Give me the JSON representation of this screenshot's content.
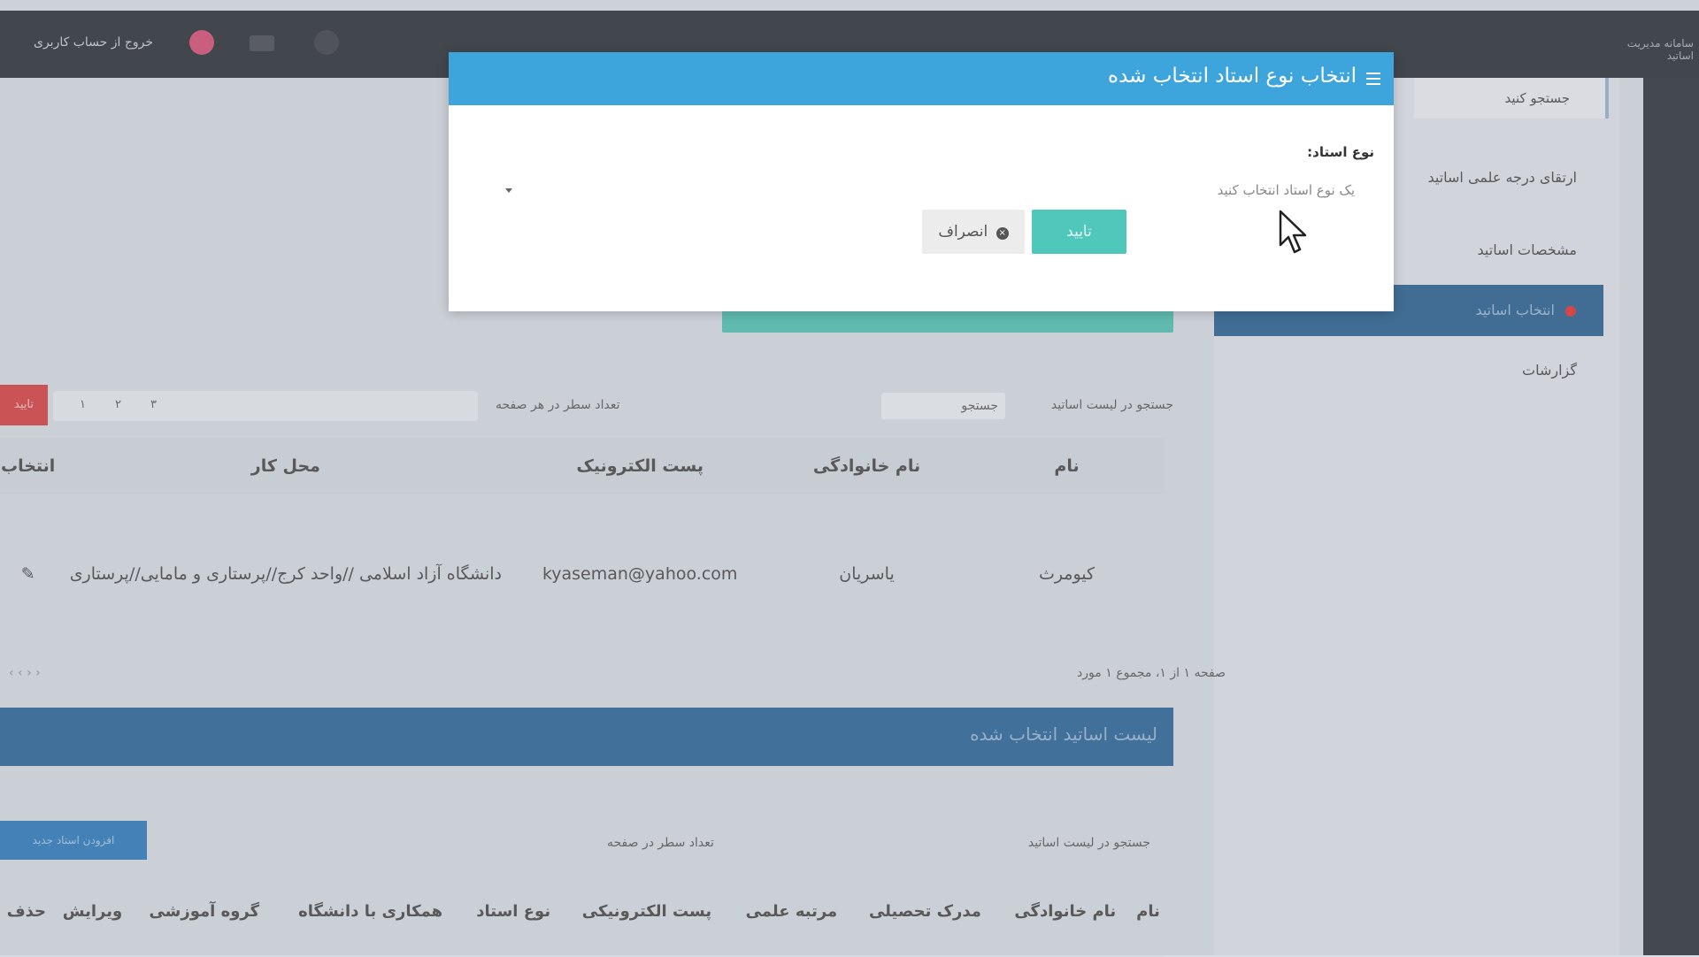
{
  "topbar": {
    "user_label": "خروج از حساب کاربری",
    "app_title": "سامانه مدیریت اساتید"
  },
  "sidebar": {
    "search_label": "جستجو کنید",
    "items": [
      {
        "label": "ارتقای درجه علمی اساتید"
      },
      {
        "label": "مشخصات اساتید"
      },
      {
        "label": "انتخاب اساتید",
        "active": true
      },
      {
        "label": "گزارشات"
      }
    ]
  },
  "grid1": {
    "search_label": "جستجو در لیست اساتید",
    "search_box": "جستجو",
    "records_label": "تعداد سطر در هر صفحه",
    "headers": [
      "نام",
      "نام خانوادگی",
      "پست الکترونیک",
      "محل کار",
      "انتخاب"
    ],
    "rows": [
      {
        "first": "کیومرث",
        "last": "یاسریان",
        "email": "kyaseman@yahoo.com",
        "workplace": "دانشگاه آزاد اسلامی //واحد کرج//پرستاری و مامایی//پرستاری"
      }
    ],
    "summary": "صفحه ۱ از ۱، مجموع ۱ مورد",
    "red_button": "تایید",
    "pager": [
      "۱",
      "۲",
      "۳"
    ]
  },
  "section2": {
    "title": "لیست اساتید انتخاب شده",
    "search_label": "جستجو در لیست اساتید",
    "records_label": "تعداد سطر در صفحه",
    "blue_button": "افزودن استاد جدید",
    "headers": [
      "نام",
      "نام خانوادگی",
      "مدرک تحصیلی",
      "مرتبه علمی",
      "پست الکترونیکی",
      "نوع استاد",
      "همکاری با دانشگاه",
      "گروه آموزشی",
      "ویرایش",
      "حذف"
    ]
  },
  "modal": {
    "title": "انتخاب نوع استاد انتخاب شده",
    "field_label": "نوع استاد:",
    "select_placeholder": "یک نوع استاد انتخاب کنید",
    "confirm_label": "تایید",
    "cancel_label": "انصراف"
  },
  "colors": {
    "modal_header": "#3ea4dc",
    "confirm": "#4fc7bb",
    "section_blue": "#3a6f9e",
    "red_btn": "#d54f4f"
  }
}
